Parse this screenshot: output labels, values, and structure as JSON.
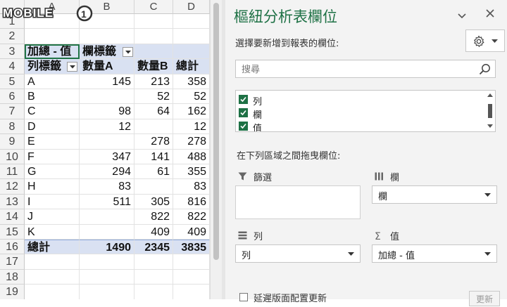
{
  "watermark": "MOBILE01",
  "columns": [
    "A",
    "B",
    "C",
    "D"
  ],
  "rows": [
    "1",
    "2",
    "3",
    "4",
    "5",
    "6",
    "7",
    "8",
    "9",
    "10",
    "11",
    "12",
    "13",
    "14",
    "15",
    "16",
    "17",
    "18",
    "19"
  ],
  "pivot": {
    "value_header": "加總 - 值",
    "col_label_header": "欄標籤",
    "row_label_header": "列標籤",
    "col_headers": [
      "數量A",
      "數量B",
      "總計"
    ],
    "data": [
      {
        "label": "A",
        "a": "145",
        "b": "213",
        "t": "358"
      },
      {
        "label": "B",
        "a": "",
        "b": "52",
        "t": "52"
      },
      {
        "label": "C",
        "a": "98",
        "b": "64",
        "t": "162"
      },
      {
        "label": "D",
        "a": "12",
        "b": "",
        "t": "12"
      },
      {
        "label": "E",
        "a": "",
        "b": "278",
        "t": "278"
      },
      {
        "label": "F",
        "a": "347",
        "b": "141",
        "t": "488"
      },
      {
        "label": "G",
        "a": "294",
        "b": "61",
        "t": "355"
      },
      {
        "label": "H",
        "a": "83",
        "b": "",
        "t": "83"
      },
      {
        "label": "I",
        "a": "511",
        "b": "305",
        "t": "816"
      },
      {
        "label": "J",
        "a": "",
        "b": "822",
        "t": "822"
      },
      {
        "label": "K",
        "a": "",
        "b": "409",
        "t": "409"
      }
    ],
    "total": {
      "label": "總計",
      "a": "1490",
      "b": "2345",
      "t": "3835"
    }
  },
  "pane": {
    "title": "樞紐分析表欄位",
    "subtitle": "選擇要新增到報表的欄位:",
    "search_placeholder": "搜尋",
    "fields": [
      {
        "label": "列",
        "checked": true
      },
      {
        "label": "欄",
        "checked": true
      },
      {
        "label": "值",
        "checked": true
      }
    ],
    "drag_label": "在下列區域之間拖曳欄位:",
    "areas": {
      "filters": {
        "title": "篩選",
        "icon": "filter-icon"
      },
      "columns": {
        "title": "欄",
        "value": "欄",
        "icon": "columns-icon"
      },
      "rows": {
        "title": "列",
        "value": "列",
        "icon": "rows-icon"
      },
      "values": {
        "title": "值",
        "value": "加總 - 值",
        "icon": "sigma-icon"
      }
    },
    "defer_label": "延遲版面配置更新",
    "update_label": "更新"
  },
  "colors": {
    "accent": "#1e7145",
    "pivot_band": "#d9e1f2"
  }
}
